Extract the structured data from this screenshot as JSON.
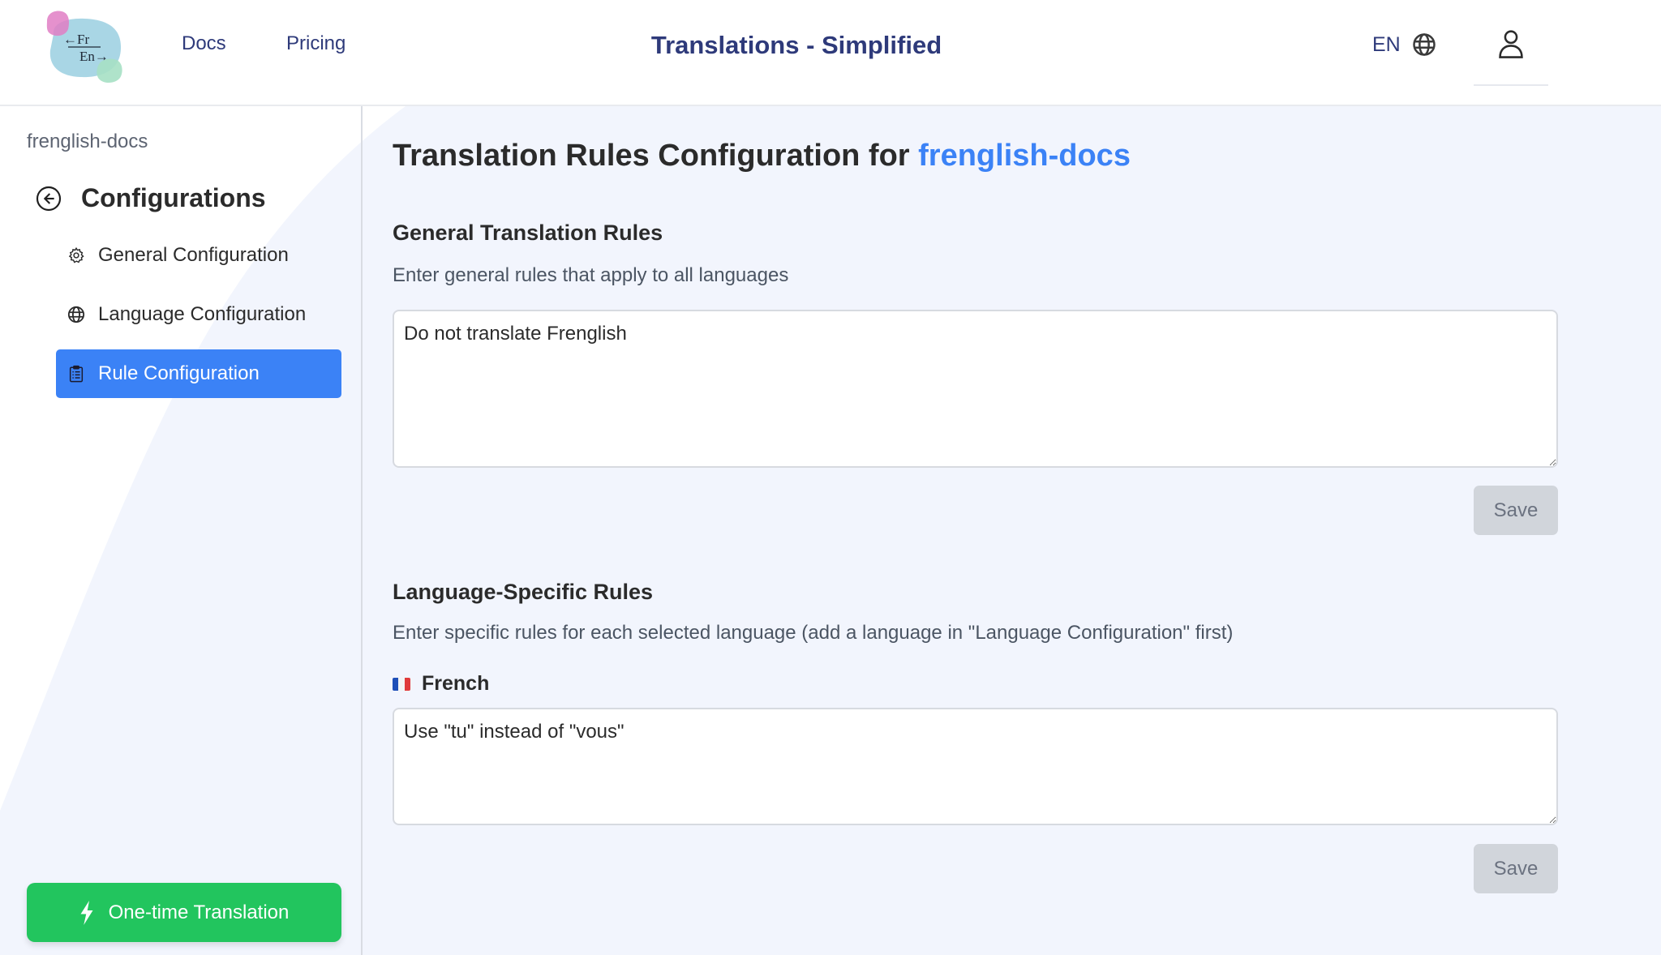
{
  "header": {
    "logo": {
      "top_text": "←Fr",
      "bottom_text": "En→",
      "alt": "frenglish-logo"
    },
    "nav": [
      {
        "label": "Docs"
      },
      {
        "label": "Pricing"
      }
    ],
    "title": "Translations - Simplified",
    "language": {
      "code": "EN",
      "icon": "globe-icon"
    },
    "user_icon": "user-icon"
  },
  "sidebar": {
    "project_name": "frenglish-docs",
    "section_title": "Configurations",
    "back_icon": "arrow-left-circle-icon",
    "items": [
      {
        "label": "General Configuration",
        "icon": "gear-icon",
        "active": false
      },
      {
        "label": "Language Configuration",
        "icon": "globe-icon",
        "active": false
      },
      {
        "label": "Rule Configuration",
        "icon": "clipboard-list-icon",
        "active": true
      }
    ],
    "one_time_button": {
      "label": "One-time Translation",
      "icon": "lightning-icon"
    }
  },
  "main": {
    "title_prefix": "Translation Rules Configuration for ",
    "title_project": "frenglish-docs",
    "general": {
      "title": "General Translation Rules",
      "description": "Enter general rules that apply to all languages",
      "value": "Do not translate Frenglish",
      "save_label": "Save"
    },
    "language_specific": {
      "title": "Language-Specific Rules",
      "description": "Enter specific rules for each selected language (add a language in \"Language Configuration\" first)",
      "languages": [
        {
          "name": "French",
          "flag": "🇫🇷",
          "value": "Use \"tu\" instead of \"vous\"",
          "save_label": "Save"
        }
      ]
    }
  },
  "colors": {
    "brand_navy": "#2e3a7a",
    "accent_blue": "#3b82f6",
    "success_green": "#22c55e",
    "disabled_gray": "#d1d5db",
    "page_bg": "#f2f5fd"
  }
}
